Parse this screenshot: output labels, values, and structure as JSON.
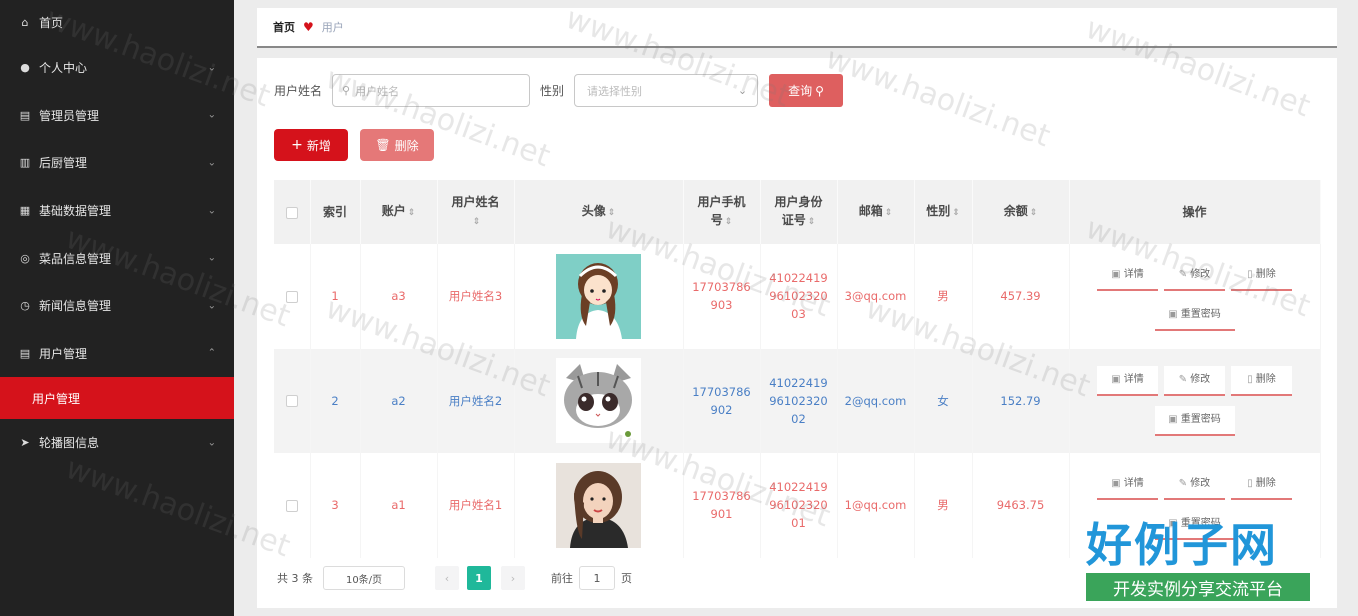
{
  "sidebar": {
    "items": [
      {
        "label": "首页",
        "icon": "home-icon",
        "glyph": "⌂"
      },
      {
        "label": "个人中心",
        "icon": "user-icon",
        "glyph": "●"
      },
      {
        "label": "管理员管理",
        "icon": "admin-icon",
        "glyph": "▤"
      },
      {
        "label": "后厨管理",
        "icon": "kitchen-icon",
        "glyph": "▥"
      },
      {
        "label": "基础数据管理",
        "icon": "grid-icon",
        "glyph": "▦"
      },
      {
        "label": "菜品信息管理",
        "icon": "dish-icon",
        "glyph": "◎"
      },
      {
        "label": "新闻信息管理",
        "icon": "clock-icon",
        "glyph": "◷"
      },
      {
        "label": "用户管理",
        "icon": "users-icon",
        "glyph": "▤"
      },
      {
        "label": "轮播图信息",
        "icon": "send-icon",
        "glyph": "➤"
      }
    ],
    "active_sub": "用户管理"
  },
  "breadcrumb": {
    "home": "首页",
    "current": "用户"
  },
  "search": {
    "name_label": "用户姓名",
    "name_placeholder": "用户姓名",
    "gender_label": "性别",
    "gender_placeholder": "请选择性别",
    "query_label": "查询"
  },
  "actions": {
    "add": "新增",
    "delete": "删除"
  },
  "table": {
    "headers": {
      "index": "索引",
      "account": "账户",
      "name": "用户姓名",
      "avatar": "头像",
      "phone": "用户手机号",
      "idcard": "用户身份证号",
      "email": "邮箱",
      "gender": "性别",
      "balance": "余额",
      "ops": "操作"
    },
    "rows": [
      {
        "index": "1",
        "account": "a3",
        "name": "用户姓名3",
        "phone": "17703786903",
        "idcard": "410224199610232003",
        "email": "3@qq.com",
        "gender": "男",
        "balance": "457.39"
      },
      {
        "index": "2",
        "account": "a2",
        "name": "用户姓名2",
        "phone": "17703786902",
        "idcard": "410224199610232002",
        "email": "2@qq.com",
        "gender": "女",
        "balance": "152.79"
      },
      {
        "index": "3",
        "account": "a1",
        "name": "用户姓名1",
        "phone": "17703786901",
        "idcard": "410224199610232001",
        "email": "1@qq.com",
        "gender": "男",
        "balance": "9463.75"
      }
    ],
    "op_labels": {
      "detail": "详情",
      "edit": "修改",
      "delete": "删除",
      "reset": "重置密码"
    }
  },
  "pagination": {
    "total": "共 3 条",
    "page_size": "10条/页",
    "current": "1",
    "goto_label": "前往",
    "goto_value": "1",
    "page_unit": "页"
  },
  "watermark": {
    "text": "www.haolizi.net",
    "logo": "好例子网",
    "logo_sub": "开发实例分享交流平台"
  },
  "colors": {
    "accent": "#d5121b",
    "sidebar": "#222222",
    "pager_active": "#1fb89a"
  }
}
